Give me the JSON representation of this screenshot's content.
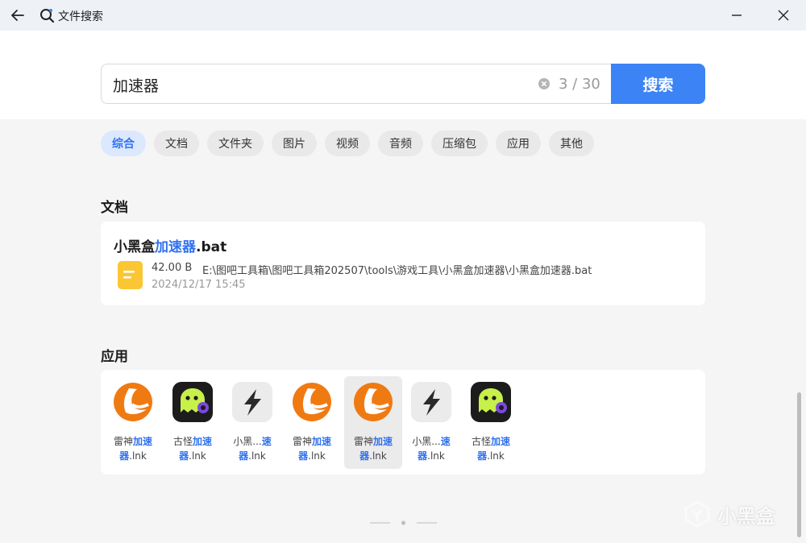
{
  "window": {
    "title": "文件搜索"
  },
  "search": {
    "query": "加速器",
    "count": "3 / 30",
    "button_label": "搜索"
  },
  "filters": [
    "综合",
    "文档",
    "文件夹",
    "图片",
    "视频",
    "音频",
    "压缩包",
    "应用",
    "其他"
  ],
  "sections": {
    "documents_title": "文档",
    "apps_title": "应用"
  },
  "document": {
    "name_prefix": "小黑盒",
    "name_match": "加速器",
    "name_suffix": ".bat",
    "size": "42.00 B",
    "path": "E:\\图吧工具箱\\图吧工具箱202507\\tools\\游戏工具\\小黑盒加速器\\小黑盒加速器.bat",
    "date": "2024/12/17 15:45",
    "icon": "document-icon"
  },
  "apps": [
    {
      "icon": "leishen-icon",
      "line1_prefix": "雷神",
      "line1_match": "加速",
      "line2_match": "器",
      "line2_suffix": ".lnk",
      "selected": false
    },
    {
      "icon": "guguai-icon",
      "line1_prefix": "古怪",
      "line1_match": "加速",
      "line2_match": "器",
      "line2_suffix": ".lnk",
      "selected": false
    },
    {
      "icon": "xiaoheihe-accelerator-icon",
      "line1_prefix": "小黑...",
      "line1_match": "速",
      "line2_match": "器",
      "line2_suffix": ".lnk",
      "selected": false
    },
    {
      "icon": "leishen-icon",
      "line1_prefix": "雷神",
      "line1_match": "加速",
      "line2_match": "器",
      "line2_suffix": ".lnk",
      "selected": false
    },
    {
      "icon": "leishen-icon",
      "line1_prefix": "雷神",
      "line1_match": "加速",
      "line2_match": "器",
      "line2_suffix": ".lnk",
      "selected": true
    },
    {
      "icon": "xiaoheihe-accelerator-icon",
      "line1_prefix": "小黑...",
      "line1_match": "速",
      "line2_match": "器",
      "line2_suffix": ".lnk",
      "selected": false
    },
    {
      "icon": "guguai-icon",
      "line1_prefix": "古怪",
      "line1_match": "加速",
      "line2_match": "器",
      "line2_suffix": ".lnk",
      "selected": false
    }
  ],
  "watermark": {
    "text": "小黑盒"
  },
  "colors": {
    "accent": "#3c83f6",
    "highlight": "#2f72f0"
  }
}
